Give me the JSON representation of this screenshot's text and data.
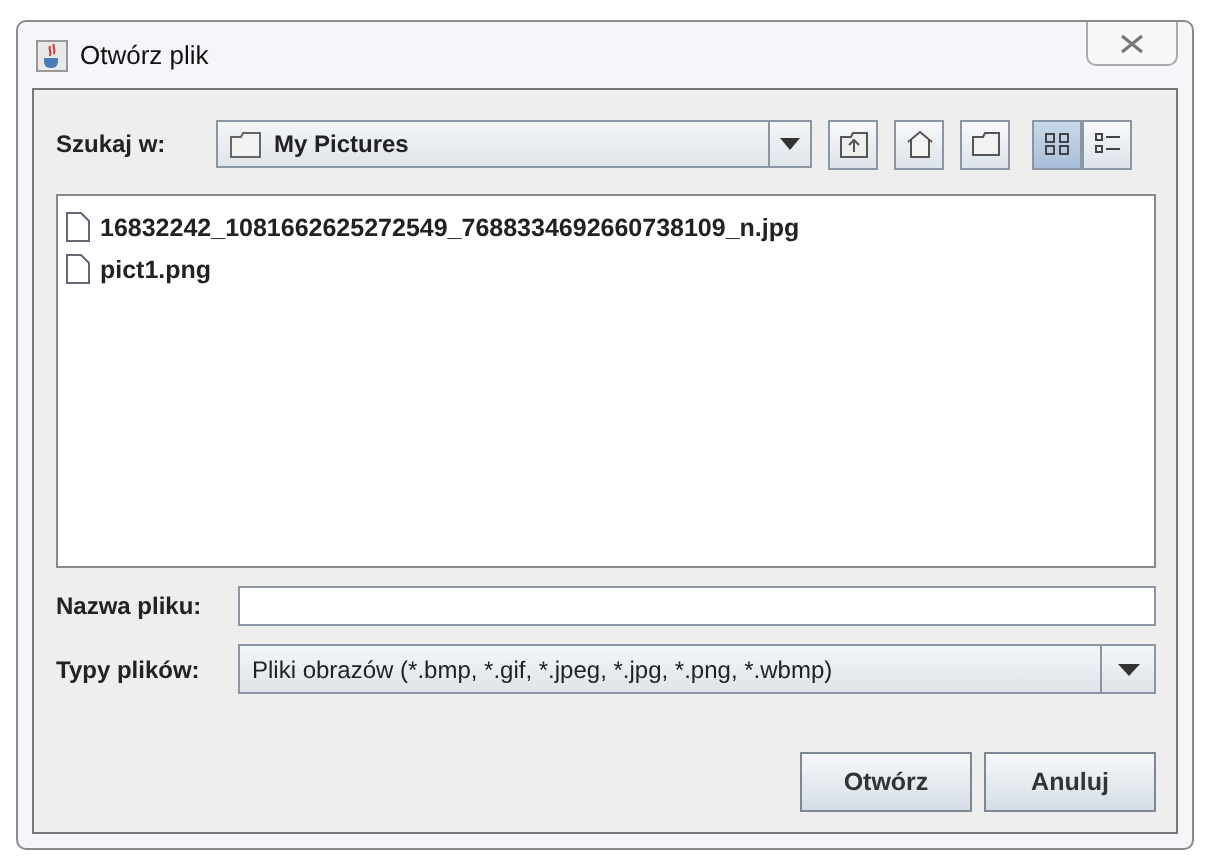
{
  "window": {
    "title": "Otwórz plik"
  },
  "look_in": {
    "label": "Szukaj w:",
    "value": "My Pictures"
  },
  "view_buttons": [
    {
      "kind": "list",
      "selected": true
    },
    {
      "kind": "details",
      "selected": false
    }
  ],
  "files": [
    {
      "name": "16832242_1081662625272549_7688334692660738109_n.jpg",
      "selected": false
    },
    {
      "name": "pict1.png",
      "selected": false
    }
  ],
  "file_name": {
    "label": "Nazwa pliku:"
  },
  "file_type": {
    "label": "Typy plików:",
    "value": "Pliki obrazów (*.bmp, *.gif, *.jpeg, *.jpg, *.png, *.wbmp)"
  },
  "buttons": [
    "Otwórz",
    "Anuluj"
  ]
}
